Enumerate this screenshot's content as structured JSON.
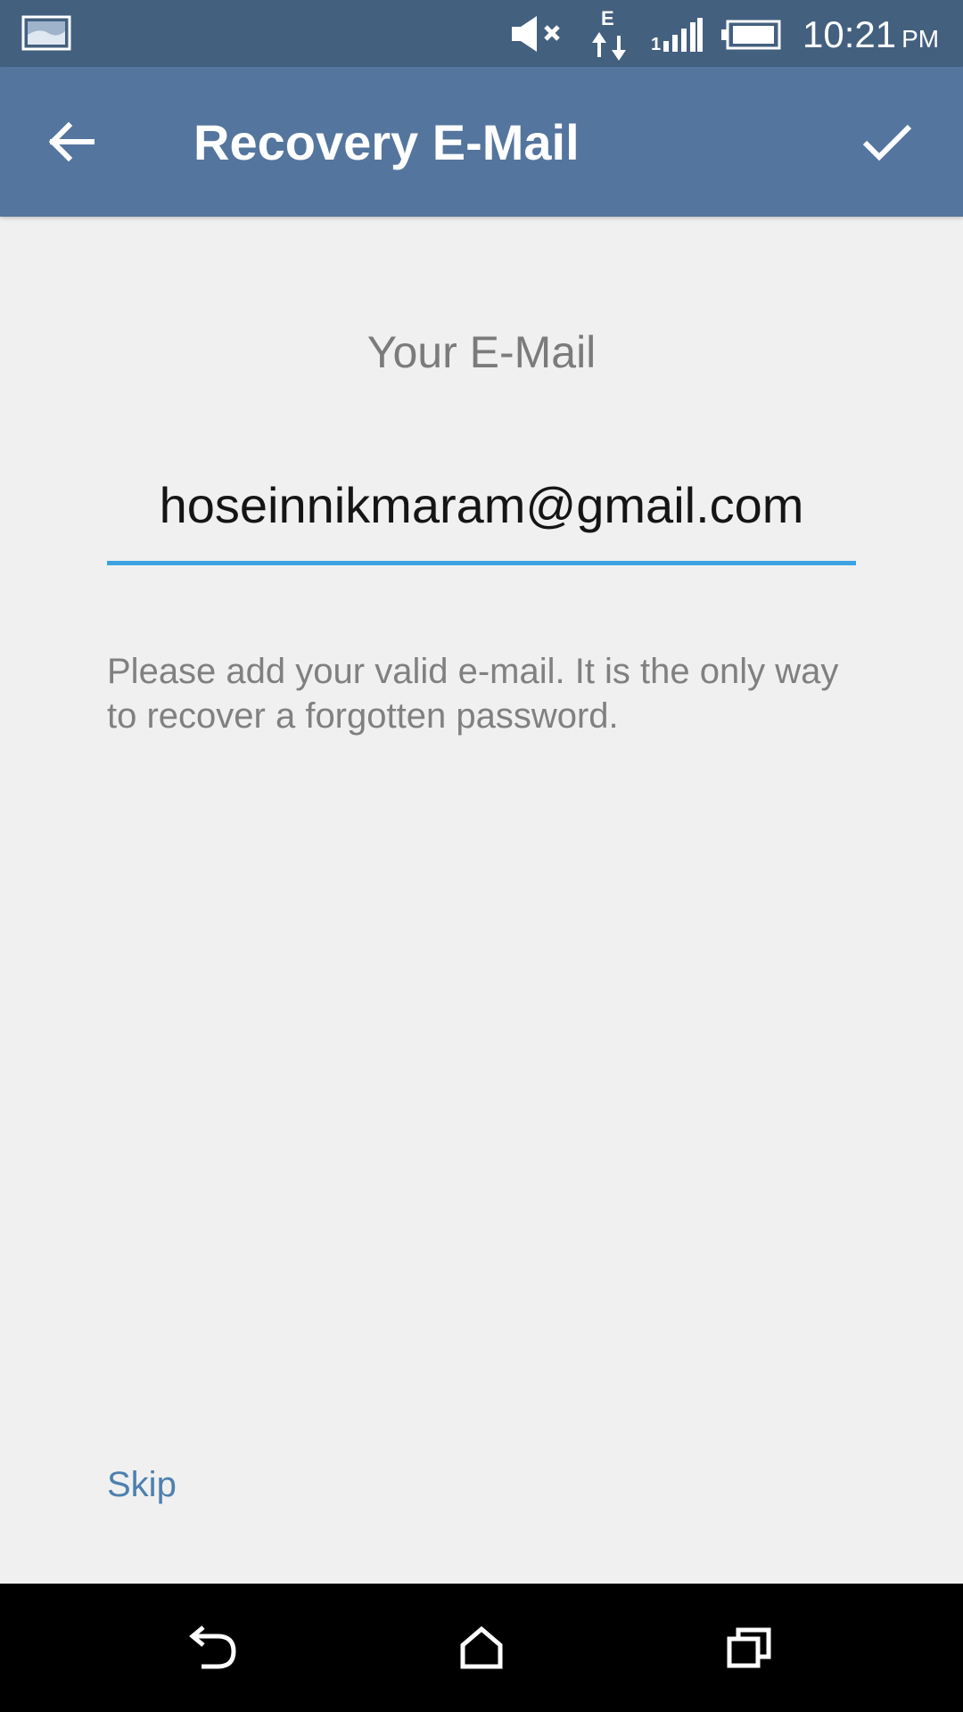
{
  "status_bar": {
    "time": "10:21",
    "ampm": "PM",
    "icons": [
      "gallery-icon",
      "mute-icon",
      "edge-data-icon",
      "signal-icon",
      "battery-icon"
    ]
  },
  "app_bar": {
    "title": "Recovery E-Mail",
    "back_icon": "arrow-left-icon",
    "done_icon": "checkmark-icon"
  },
  "form": {
    "label": "Your E-Mail",
    "email_value": "hoseinnikmaram@gmail.com",
    "hint": "Please add your valid e-mail. It is the only way to recover a forgotten password.",
    "skip_label": "Skip"
  },
  "nav_bar": {
    "icons": [
      "back-icon",
      "home-icon",
      "recents-icon"
    ]
  },
  "colors": {
    "status_bar": "#44607f",
    "app_bar": "#54759e",
    "background": "#f0f0f0",
    "accent_underline": "#3ba3e1",
    "link": "#4d80ae"
  }
}
